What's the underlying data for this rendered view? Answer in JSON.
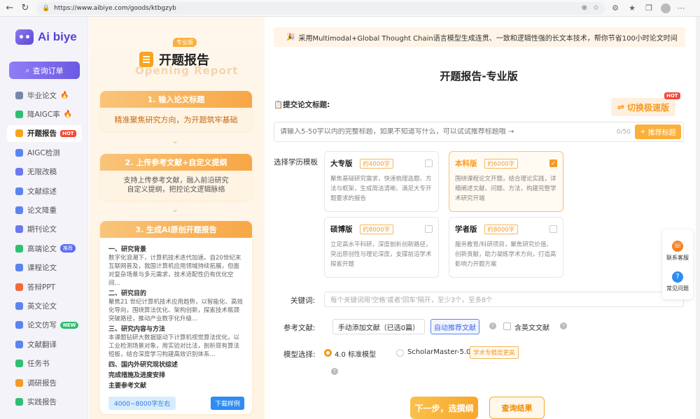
{
  "browser": {
    "url": "https://www.aibiye.com/goods/ktbgzyb"
  },
  "sidebar": {
    "logo_text": "Ai biye",
    "query_label": "查询订单",
    "items": [
      {
        "label": "毕业论文",
        "icon": "graduation-icon",
        "color": "#7a86a8",
        "badge": "fire"
      },
      {
        "label": "降AIGC率",
        "icon": "ai-icon",
        "color": "#2fbf71",
        "badge": "fire"
      },
      {
        "label": "开题报告",
        "icon": "report-icon",
        "color": "#f9a41e",
        "badge": "HOT"
      },
      {
        "label": "AIGC检测",
        "icon": "detect-icon",
        "color": "#5b84f0",
        "badge": ""
      },
      {
        "label": "无限改稿",
        "icon": "edit-icon",
        "color": "#6b78f0",
        "badge": ""
      },
      {
        "label": "文献综述",
        "icon": "book-icon",
        "color": "#5b84f0",
        "badge": ""
      },
      {
        "label": "论文降重",
        "icon": "reduce-icon",
        "color": "#5b84f0",
        "badge": ""
      },
      {
        "label": "期刊论文",
        "icon": "journal-icon",
        "color": "#6b78f0",
        "badge": ""
      },
      {
        "label": "高端论文",
        "icon": "premium-icon",
        "color": "#2fbf71",
        "badge": "推荐"
      },
      {
        "label": "课程论文",
        "icon": "course-icon",
        "color": "#5b84f0",
        "badge": ""
      },
      {
        "label": "答辩PPT",
        "icon": "ppt-icon",
        "color": "#f46a3a",
        "badge": ""
      },
      {
        "label": "英文论文",
        "icon": "english-icon",
        "color": "#5b84f0",
        "badge": ""
      },
      {
        "label": "论文仿写",
        "icon": "imitate-icon",
        "color": "#5b84f0",
        "badge": "NEW"
      },
      {
        "label": "文献翻译",
        "icon": "translate-icon",
        "color": "#5b84f0",
        "badge": ""
      },
      {
        "label": "任务书",
        "icon": "task-icon",
        "color": "#2fbf71",
        "badge": ""
      },
      {
        "label": "调研报告",
        "icon": "survey-icon",
        "color": "#f59a23",
        "badge": ""
      },
      {
        "label": "实践报告",
        "icon": "practice-icon",
        "color": "#2fbf71",
        "badge": ""
      }
    ]
  },
  "left_panel": {
    "badge": "专业版",
    "title": "开题报告",
    "bg_text": "Opening Report",
    "step1": {
      "title": "1. 输入论文标题",
      "desc": "精准聚焦研究方向，为开题筑牢基础"
    },
    "step2": {
      "title": "2. 上传参考文献+自定义提纲",
      "desc1": "支持上传参考文献，融入前沿研究",
      "desc2": "自定义提纲，把控论文逻辑脉络"
    },
    "step3": {
      "title": "3. 生成AI原创开题报告",
      "sections": [
        {
          "h": "一、研究背景",
          "t": "数字化浪潮下，计算机技术迭代加速。自20世纪末互联网普及，我国计算机应用领域持续拓展，但面对复杂场景与多元需求，技术适配性仍有优化空间..."
        },
        {
          "h": "二、研究目的",
          "t": "聚焦21 世纪计算机技术应用趋势，以智能化、高效化导向，围绕算法优化、架构创新，探索技术瓶颈突破路径，推动产业数字化升级..."
        },
        {
          "h": "三、研究内容与方法",
          "t": "本课题钻研大数据驱动下计算机视觉算法优化，以工业检测场景对象，用实验对比法，剖析现有算法短板，结合深度学习构建高效识别体系..."
        },
        {
          "h": "四、国内外研究现状综述",
          "t": ""
        },
        {
          "h": "完成措施及进度安排",
          "t": ""
        },
        {
          "h": "主要参考文献",
          "t": ""
        }
      ],
      "word_count": "4000~8000字左右",
      "download": "下载样例"
    }
  },
  "main": {
    "banner": "采用Multimodal+Global Thought Chain语言模型生成连贯、一致和逻辑性强的长文本技术，帮你节省100小时论文时间",
    "page_title": "开题报告-专业版",
    "title_label": "提交论文标题:",
    "speed_btn": "切换极速版",
    "speed_hot": "HOT",
    "title_placeholder": "请输入5-50字以内的完整标题，如果不知道写什么，可以试试推荐标题哦 →",
    "title_count": "0/50",
    "recommend_btn": "推荐标题",
    "edu_label": "选择学历模板",
    "cards": [
      {
        "name": "大专版",
        "words": "约4000字",
        "desc": "聚焦基础研究需求，快速梳理选题、方法与框架，生成简洁清晰、满足大专开题要求的报告",
        "selected": false
      },
      {
        "name": "本科版",
        "words": "约6000字",
        "desc": "围绕课程论文开题，结合理论实践，详细阐述文献、问题、方法，构建完整学术研究开端",
        "selected": true
      },
      {
        "name": "硕博版",
        "words": "约8000字",
        "desc": "立足高水平科研，深度剖析创新路径，突出原创性与理论深度，支撑前沿学术探索开题",
        "selected": false
      },
      {
        "name": "学者版",
        "words": "约8000字",
        "desc": "服务教育/科研项目，聚焦研究价值、创新贡献，助力凝练学术方向，打造高影响力开题方案",
        "selected": false
      }
    ],
    "kw_label": "关键词:",
    "kw_placeholder": "每个关键词用'空格'或者'回车'隔开，至少3个，至多8个",
    "ref_label": "参考文献:",
    "manual_ref": "手动添加文献（已选0篇）",
    "auto_ref": "自动推荐文献",
    "eng_ref": "含英文文献",
    "model_label": "模型选择:",
    "model1": "4.0 标准模型",
    "model2": "ScholarMaster-5.0",
    "model_badge": "学术专精度更高",
    "next_btn": "下一步，选撰纲",
    "result_btn": "查询结果"
  },
  "float": {
    "service": "联系客服",
    "faq": "常见问题"
  }
}
